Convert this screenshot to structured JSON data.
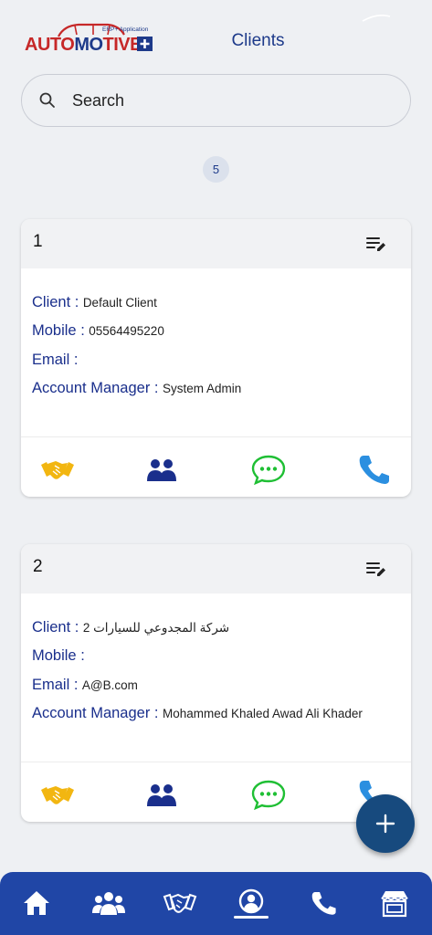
{
  "header": {
    "logo_text": "AUTOMOTIVE",
    "logo_subtext": "ERP+ Application",
    "title": "Clients"
  },
  "search": {
    "placeholder": "Search"
  },
  "results_count": "5",
  "labels": {
    "client": "Client :",
    "mobile": "Mobile :",
    "email": "Email :",
    "account_manager": "Account Manager :"
  },
  "clients": [
    {
      "number": "1",
      "client": "Default Client",
      "mobile": "05564495220",
      "email": "",
      "account_manager": "System Admin"
    },
    {
      "number": "2",
      "client": "شركة المجدوعي للسيارات 2",
      "mobile": "",
      "email": "A@B.com",
      "account_manager": "Mohammed Khaled Awad Ali Khader"
    }
  ],
  "card_actions": [
    "handshake-icon",
    "people-icon",
    "chat-icon",
    "phone-icon"
  ],
  "bottom_nav": [
    "home-icon",
    "users-icon",
    "deals-icon",
    "profile-icon",
    "phone-icon",
    "store-icon"
  ],
  "colors": {
    "primary": "#2046a6",
    "label_blue": "#1a2f8c",
    "fab": "#174a7e",
    "handshake": "#f2b611",
    "chat": "#1fbf34",
    "phone": "#2b8fe0"
  }
}
